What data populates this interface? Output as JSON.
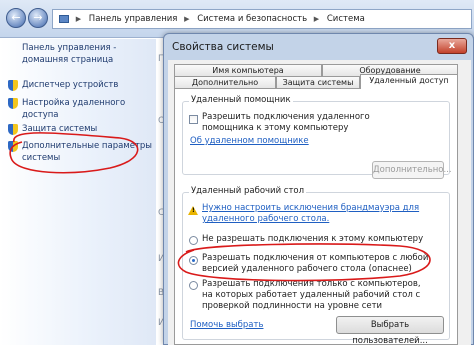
{
  "address_bar": {
    "back_icon": "back-arrow-icon",
    "forward_icon": "forward-arrow-icon",
    "breadcrumbs": [
      "Панель управления",
      "Система и безопасность",
      "Система"
    ]
  },
  "left_pane": {
    "home_link": "Панель управления - домашняя страница",
    "tasks": [
      {
        "label": "Диспетчер устройств",
        "icon": "uac-shield-icon"
      },
      {
        "label": "Настройка удаленного доступа",
        "icon": "uac-shield-icon"
      },
      {
        "label": "Защита системы",
        "icon": "uac-shield-icon"
      },
      {
        "label": "Дополнительные параметры системы",
        "icon": "uac-shield-icon"
      }
    ]
  },
  "background_chars": [
    "П",
    "О",
    "С",
    "И",
    "В",
    "И"
  ],
  "dialog": {
    "title": "Свойства системы",
    "close_label": "x",
    "tabs_row1": [
      "Имя компьютера",
      "Оборудование"
    ],
    "tabs_row2": [
      "Дополнительно",
      "Защита системы",
      "Удаленный доступ"
    ],
    "active_tab": "Удаленный доступ",
    "remote_assistance": {
      "title": "Удаленный помощник",
      "checkbox_label": "Разрешить подключения удаленного помощника к этому компьютеру",
      "checkbox_checked": false,
      "help_link": "Об удаленном помощнике",
      "advanced_button": "Дополнительно..."
    },
    "remote_desktop": {
      "title": "Удаленный рабочий стол",
      "warning_link": "Нужно настроить исключения брандмауэра для удаленного рабочего стола.",
      "options": [
        {
          "label": "Не разрешать подключения к этому компьютеру",
          "selected": false
        },
        {
          "label": "Разрешать подключения от компьютеров с любой версией удаленного рабочего стола (опаснее)",
          "selected": true
        },
        {
          "label": "Разрешать подключения только с компьютеров, на которых работает удаленный рабочий стол с проверкой подлинности на уровне сети",
          "selected": false
        }
      ],
      "help_link": "Помочь выбрать",
      "select_users_button": "Выбрать пользователей..."
    }
  },
  "colors": {
    "annotation_red": "#d91a1a",
    "link_blue": "#1f5fc2"
  }
}
